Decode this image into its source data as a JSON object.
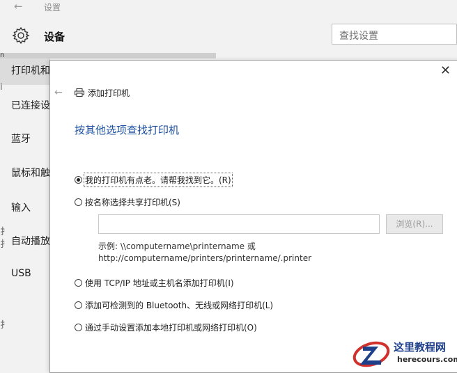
{
  "settings": {
    "title": "设置",
    "section_title": "设备",
    "search_placeholder": "查找设置",
    "nav": {
      "items": [
        {
          "label": "打印机和"
        },
        {
          "label": "已连接设"
        },
        {
          "label": "蓝牙"
        },
        {
          "label": "鼠标和触"
        },
        {
          "label": "输入"
        },
        {
          "label": "自动播放"
        },
        {
          "label": "USB"
        }
      ]
    },
    "fragments": [
      "n",
      "i",
      "扌",
      "扌",
      "扌"
    ]
  },
  "dialog": {
    "header": "添加打印机",
    "heading": "按其他选项查找打印机",
    "options": [
      {
        "label": "我的打印机有点老。请帮我找到它。(R)",
        "checked": true
      },
      {
        "label": "按名称选择共享打印机(S)",
        "checked": false
      },
      {
        "label": "使用 TCP/IP 地址或主机名添加打印机(I)",
        "checked": false
      },
      {
        "label": "添加可检测到的 Bluetooth、无线或网络打印机(L)",
        "checked": false
      },
      {
        "label": "通过手动设置添加本地打印机或网络打印机(O)",
        "checked": false
      }
    ],
    "share_input_value": "",
    "browse_label": "浏览(R)...",
    "example_line1": "示例: \\\\computername\\printername 或",
    "example_line2": "http://computername/printers/printername/.printer"
  },
  "watermark": {
    "site_cn": "这里教程网",
    "site_url": "herecours.com",
    "colors": {
      "red": "#d0312d",
      "blue": "#1e3f8a"
    }
  }
}
